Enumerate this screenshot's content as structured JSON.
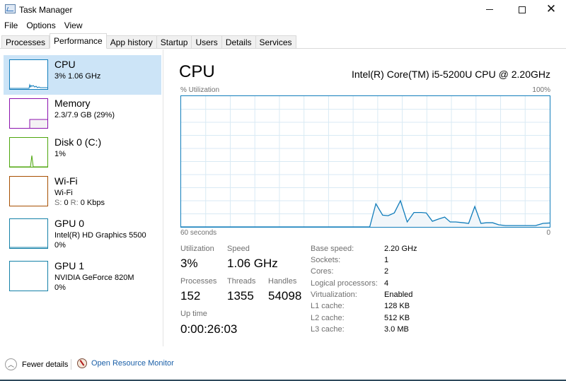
{
  "window": {
    "title": "Task Manager",
    "controls": {
      "minimize": "minimize",
      "maximize": "maximize",
      "close": "close"
    }
  },
  "menu": [
    "File",
    "Options",
    "View"
  ],
  "tabs": [
    {
      "label": "Processes",
      "active": false
    },
    {
      "label": "Performance",
      "active": true
    },
    {
      "label": "App history",
      "active": false
    },
    {
      "label": "Startup",
      "active": false
    },
    {
      "label": "Users",
      "active": false
    },
    {
      "label": "Details",
      "active": false
    },
    {
      "label": "Services",
      "active": false
    }
  ],
  "sidebar": {
    "items": [
      {
        "name": "CPU",
        "line1": "3%  1.06 GHz",
        "line2": "",
        "color": "#117dbb",
        "selected": true
      },
      {
        "name": "Memory",
        "line1": "2.3/7.9 GB (29%)",
        "line2": "",
        "color": "#8b12ae",
        "selected": false
      },
      {
        "name": "Disk 0 (C:)",
        "line1": "1%",
        "line2": "",
        "color": "#4da60c",
        "selected": false
      },
      {
        "name": "Wi-Fi",
        "line1": "Wi-Fi",
        "line2_label_s": "S:",
        "line2_value_s": "0",
        "line2_label_r": "R:",
        "line2_value_r": "0 Kbps",
        "color": "#a74f01",
        "selected": false
      },
      {
        "name": "GPU 0",
        "line1": "Intel(R) HD Graphics 5500",
        "line2": "0%",
        "color": "#1581a8",
        "selected": false
      },
      {
        "name": "GPU 1",
        "line1": "NVIDIA GeForce 820M",
        "line2": "0%",
        "color": "#1581a8",
        "selected": false
      }
    ]
  },
  "main": {
    "title": "CPU",
    "model": "Intel(R) Core(TM) i5-5200U CPU @ 2.20GHz",
    "graph": {
      "ylabel": "% Utilization",
      "ymax_label": "100%",
      "xstart_label": "60 seconds",
      "xend_label": "0"
    },
    "stats": {
      "utilization_label": "Utilization",
      "utilization": "3%",
      "speed_label": "Speed",
      "speed": "1.06 GHz",
      "processes_label": "Processes",
      "processes": "152",
      "threads_label": "Threads",
      "threads": "1355",
      "handles_label": "Handles",
      "handles": "54098",
      "uptime_label": "Up time",
      "uptime": "0:00:26:03"
    },
    "specs": [
      {
        "label": "Base speed:",
        "value": "2.20 GHz"
      },
      {
        "label": "Sockets:",
        "value": "1"
      },
      {
        "label": "Cores:",
        "value": "2"
      },
      {
        "label": "Logical processors:",
        "value": "4"
      },
      {
        "label": "Virtualization:",
        "value": "Enabled"
      },
      {
        "label": "L1 cache:",
        "value": "128 KB"
      },
      {
        "label": "L2 cache:",
        "value": "512 KB"
      },
      {
        "label": "L3 cache:",
        "value": "3.0 MB"
      }
    ]
  },
  "footer": {
    "fewer_details": "Fewer details",
    "open_resource_monitor": "Open Resource Monitor"
  },
  "chart_data": {
    "type": "area",
    "title": "% Utilization",
    "xlabel": "60 seconds",
    "xlim": [
      60,
      0
    ],
    "ylim": [
      0,
      100
    ],
    "grid": true,
    "color": "#117dbb",
    "fill": "#f1f6fa",
    "x_seconds_ago": [
      60,
      29.3,
      28.3,
      27.2,
      26.3,
      25.3,
      24.3,
      23.2,
      22.1,
      20.9,
      20.1,
      19.1,
      18.1,
      17.1,
      16.2,
      15.3,
      14.1,
      13.2,
      12.2,
      11.2,
      10.3,
      9.3,
      8.3,
      7.2,
      2.3,
      1.1,
      0
    ],
    "values": [
      0,
      0,
      17.7,
      9,
      8.6,
      10.7,
      20,
      3.8,
      11,
      11,
      10.7,
      4.3,
      6,
      7.5,
      3.8,
      3.8,
      3.2,
      2.7,
      15.6,
      2.7,
      3.2,
      3.2,
      1.6,
      1,
      1,
      2.7,
      3
    ]
  }
}
